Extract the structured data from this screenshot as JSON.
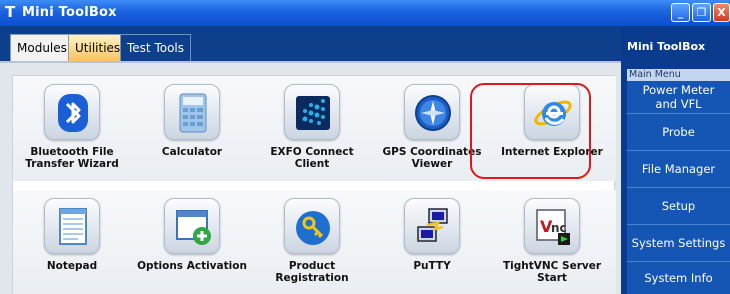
{
  "window": {
    "title": "Mini ToolBox",
    "title_icon": "T",
    "controls": {
      "minimize": "_",
      "restore": "❐",
      "close": "X"
    }
  },
  "tabs": [
    {
      "label": "Modules",
      "state": "normal"
    },
    {
      "label": "Utilities",
      "state": "active"
    },
    {
      "label": "Test Tools",
      "state": "normal"
    }
  ],
  "apps": [
    {
      "label": "Bluetooth File\nTransfer Wizard",
      "icon": "bluetooth-icon"
    },
    {
      "label": "Calculator",
      "icon": "calculator-icon"
    },
    {
      "label": "EXFO Connect Client",
      "icon": "exfo-connect-icon"
    },
    {
      "label": "GPS Coordinates\nViewer",
      "icon": "gps-compass-icon"
    },
    {
      "label": "Internet Explorer",
      "icon": "internet-explorer-icon",
      "highlighted": true
    },
    {
      "label": "Notepad",
      "icon": "notepad-icon"
    },
    {
      "label": "Options Activation",
      "icon": "options-activation-icon"
    },
    {
      "label": "Product\nRegistration",
      "icon": "product-registration-icon"
    },
    {
      "label": "PuTTY",
      "icon": "putty-icon"
    },
    {
      "label": "TightVNC Server\nStart",
      "icon": "tightvnc-icon"
    }
  ],
  "sidebar": {
    "title": "Mini ToolBox",
    "menu_header": "Main Menu",
    "items": [
      "Power Meter\nand VFL",
      "Probe",
      "File Manager",
      "Setup",
      "System Settings",
      "System Info"
    ]
  },
  "colors": {
    "highlight": "#e01818",
    "sidebar": "#0a3b8c",
    "active_tab": "#f9c45e"
  }
}
